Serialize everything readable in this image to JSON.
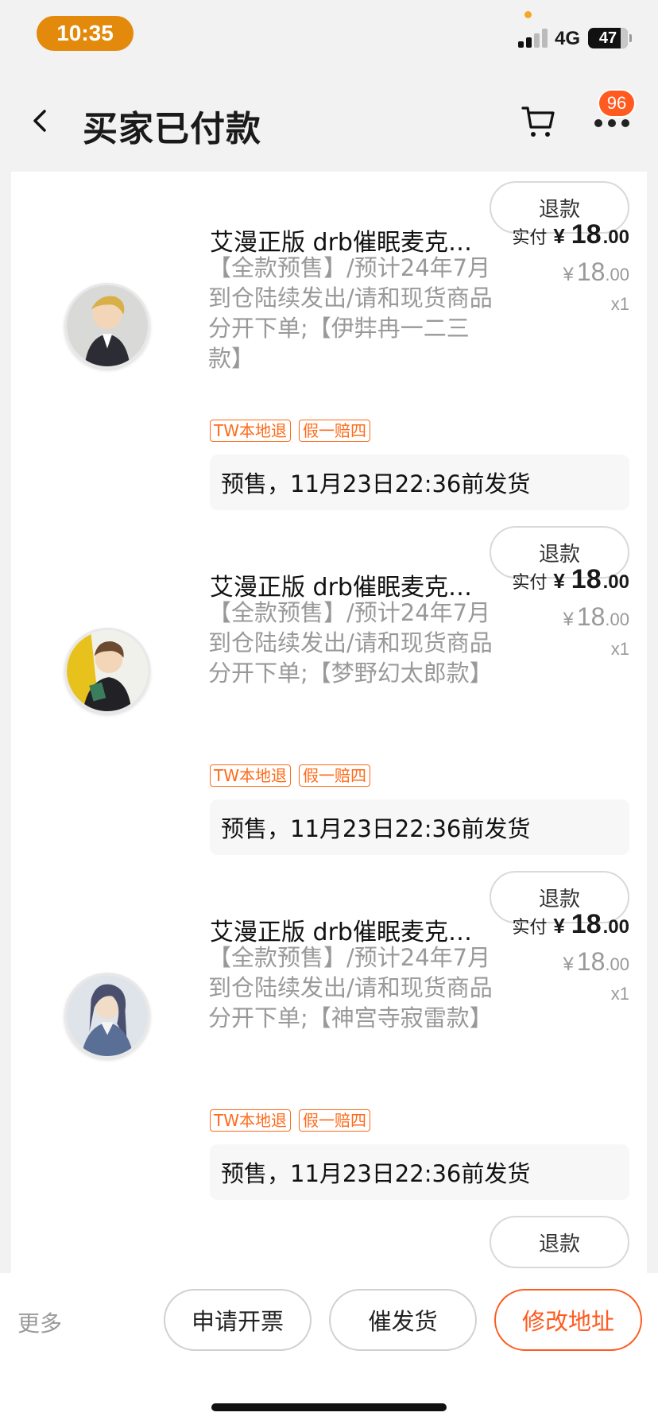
{
  "status_bar": {
    "time": "10:35",
    "network": "4G",
    "battery": "47",
    "accent_color": "#e38a0c"
  },
  "header": {
    "title": "买家已付款",
    "badge_count": "96",
    "icons": [
      "chevron-left-icon",
      "cart-icon",
      "more-dots-icon"
    ]
  },
  "items": [
    {
      "refund_label": "退款",
      "title": "艾漫正版 drb催眠麦克风立牌吧唧",
      "description": "【全款预售】/预计24年7月到仓陆续发出/请和现货商品分开下单;【伊弉冉一二三款】",
      "tags": [
        "TW本地退",
        "假一赔四"
      ],
      "paid_label": "实付",
      "currency": "¥",
      "paid_int": "18",
      "paid_dec": ".00",
      "orig_int": "18",
      "orig_dec": ".00",
      "qty_prefix": "x",
      "qty": "1",
      "shipping": "预售，11月23日22:36前发货"
    },
    {
      "refund_label": "退款",
      "title": "艾漫正版 drb催眠麦克风立牌吧唧",
      "description": "【全款预售】/预计24年7月到仓陆续发出/请和现货商品分开下单;【梦野幻太郎款】",
      "tags": [
        "TW本地退",
        "假一赔四"
      ],
      "paid_label": "实付",
      "currency": "¥",
      "paid_int": "18",
      "paid_dec": ".00",
      "orig_int": "18",
      "orig_dec": ".00",
      "qty_prefix": "x",
      "qty": "1",
      "shipping": "预售，11月23日22:36前发货"
    },
    {
      "refund_label": "退款",
      "title": "艾漫正版 drb催眠麦克风立牌吧唧",
      "description": "【全款预售】/预计24年7月到仓陆续发出/请和现货商品分开下单;【神宫寺寂雷款】",
      "tags": [
        "TW本地退",
        "假一赔四"
      ],
      "paid_label": "实付",
      "currency": "¥",
      "paid_int": "18",
      "paid_dec": ".00",
      "orig_int": "18",
      "orig_dec": ".00",
      "qty_prefix": "x",
      "qty": "1",
      "shipping": "预售，11月23日22:36前发货"
    }
  ],
  "last_refund_label": "退款",
  "bottom_bar": {
    "more": "更多",
    "invoice": "申请开票",
    "urge": "催发货",
    "change_address": "修改地址",
    "primary_color": "#ff5a1f"
  }
}
